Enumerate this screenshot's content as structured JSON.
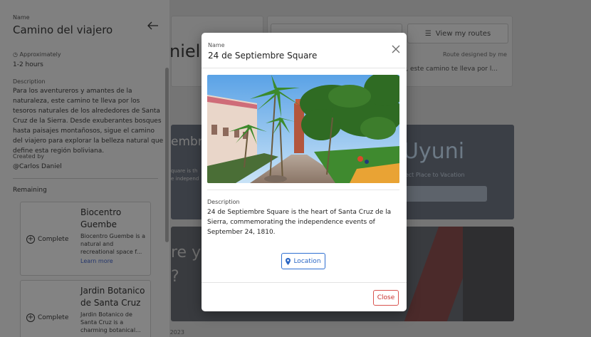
{
  "background": {
    "name_fragment": "niel",
    "view_routes_label": "View my routes",
    "designed_by": "Route designed by me",
    "snippet": "za, este camino te lleva por l...",
    "card1_title_fragment": "embre",
    "card1_text_line1": "quare is th",
    "card1_text_line2": "e independ",
    "card1_uyuni": "Uyuni",
    "card1_vacation": "fect Place to Vacation",
    "card1_input_fragment": "s",
    "card2_fragment_line1": "re y",
    "card2_fragment_line2": "?",
    "year_fragment": "2023"
  },
  "side_panel": {
    "name_label": "Name",
    "title": "Camino del viajero",
    "approx_label": "Approximately",
    "hours": "1-2 hours",
    "description_label": "Description",
    "description": "Para los aventureros y amantes de la naturaleza, este camino te lleva por los tesoros naturales de los alrededores de Santa Cruz de la Sierra. Desde exuberantes bosques hasta paisajes montañosos, sigue el camino del viajero para explorar la belleza natural que define esta región boliviana.",
    "created_label": "Created by",
    "created_by": "@Carlos Daniel",
    "remaining_label": "Remaining",
    "places": [
      {
        "complete_label": "Complete",
        "title": "Biocentro Guembe",
        "desc": "Biocentro Guembe is a natural and recreational space f...",
        "learn_more": "Learn more"
      },
      {
        "complete_label": "Complete",
        "title": "Jardin Botanico de Santa Cruz",
        "desc": "Jardin Botanico de Santa Cruz is a charming botanical..."
      }
    ]
  },
  "modal": {
    "name_label": "Name",
    "title": "24 de Septiembre Square",
    "description_label": "Description",
    "description": "24 de Septiembre Square is the heart of Santa Cruz de la Sierra, commemorating the independence events of September 24, 1810.",
    "location_label": "Location",
    "close_label": "Close"
  },
  "colors": {
    "primary": "#2e6fd1",
    "danger": "#d9534f",
    "overlay": "#5f5f5f"
  }
}
